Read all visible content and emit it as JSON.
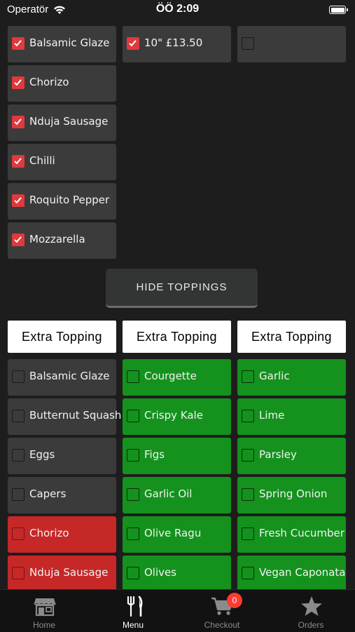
{
  "status_bar": {
    "carrier": "Operatör",
    "time": "ÖÖ 2:09"
  },
  "selected_toppings": [
    {
      "label": "Balsamic Glaze",
      "checked": true
    },
    {
      "label": "Chorizo",
      "checked": true
    },
    {
      "label": "Nduja Sausage",
      "checked": true
    },
    {
      "label": "Chilli",
      "checked": true
    },
    {
      "label": "Roquito Pepper",
      "checked": true
    },
    {
      "label": "Mozzarella",
      "checked": true
    }
  ],
  "size_option": {
    "label": "10\" £13.50",
    "checked": true
  },
  "third_option": {
    "label": "",
    "checked": false
  },
  "hide_toppings_label": "HIDE TOPPINGS",
  "extra_headers": [
    "Extra Topping",
    "Extra Topping",
    "Extra Topping"
  ],
  "extra_columns": [
    [
      {
        "label": "Balsamic Glaze",
        "color": "#3b3b3b"
      },
      {
        "label": "Butternut Squash",
        "color": "#3b3b3b"
      },
      {
        "label": "Eggs",
        "color": "#3b3b3b"
      },
      {
        "label": "Capers",
        "color": "#3b3b3b"
      },
      {
        "label": "Chorizo",
        "color": "#c62828"
      },
      {
        "label": "Nduja Sausage",
        "color": "#c62828"
      }
    ],
    [
      {
        "label": "Courgette",
        "color": "#14921d"
      },
      {
        "label": "Crispy Kale",
        "color": "#14921d"
      },
      {
        "label": "Figs",
        "color": "#14921d"
      },
      {
        "label": "Garlic Oil",
        "color": "#14921d"
      },
      {
        "label": "Olive Ragu",
        "color": "#14921d"
      },
      {
        "label": "Olives",
        "color": "#14921d"
      }
    ],
    [
      {
        "label": "Garlic",
        "color": "#14921d"
      },
      {
        "label": "Lime",
        "color": "#14921d"
      },
      {
        "label": "Parsley",
        "color": "#14921d"
      },
      {
        "label": "Spring Onion",
        "color": "#14921d"
      },
      {
        "label": "Fresh Cucumber",
        "color": "#14921d"
      },
      {
        "label": "Vegan Caponata",
        "color": "#14921d"
      }
    ]
  ],
  "tabs": {
    "home": "Home",
    "menu": "Menu",
    "checkout": "Checkout",
    "orders": "Orders",
    "checkout_badge": "0"
  },
  "colors": {
    "background": "#1e1d1d",
    "tile_dark": "#3b3b3b",
    "tile_green": "#14921d",
    "tile_red": "#c62828",
    "checkbox_checked": "#e0393e",
    "badge": "#ff3b30"
  }
}
